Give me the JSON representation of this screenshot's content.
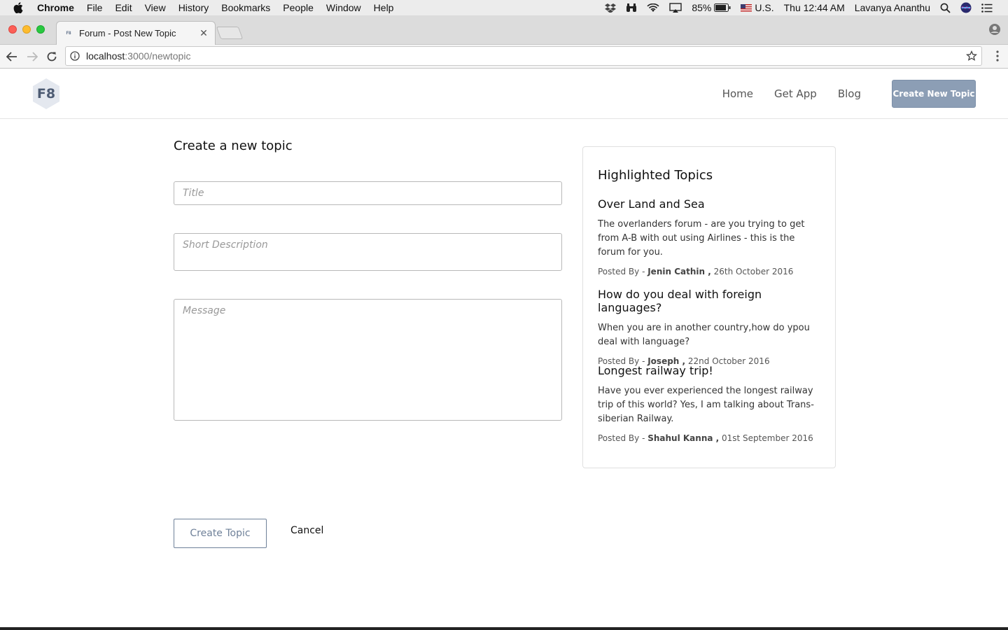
{
  "menubar": {
    "app_name": "Chrome",
    "items": [
      "File",
      "Edit",
      "View",
      "History",
      "Bookmarks",
      "People",
      "Window",
      "Help"
    ],
    "battery": "85%",
    "input_source": "U.S.",
    "clock": "Thu 12:44 AM",
    "user": "Lavanya Ananthu"
  },
  "browser": {
    "tab_title": "Forum - Post New Topic",
    "favicon_text": "F8",
    "url_host": "localhost",
    "url_path": ":3000/newtopic"
  },
  "header": {
    "logo_text": "F8",
    "nav": [
      "Home",
      "Get App",
      "Blog"
    ],
    "cta_label": "Create New Topic"
  },
  "form": {
    "heading": "Create a new topic",
    "title_placeholder": "Title",
    "description_placeholder": "Short Description",
    "message_placeholder": "Message",
    "submit_label": "Create Topic",
    "cancel_label": "Cancel"
  },
  "sidebar": {
    "heading": "Highlighted Topics",
    "topics": [
      {
        "title": "Over Land and Sea",
        "body": "The overlanders forum - are you trying to get from A-B with out using Airlines - this is the forum for you.",
        "posted_prefix": "Posted By - ",
        "author": "Jenin Cathin ,",
        "date": " 26th October 2016"
      },
      {
        "title": "How do you deal with foreign languages?",
        "body": "When you are in another country,how do ypou deal with language?",
        "posted_prefix": "Posted By - ",
        "author": "Joseph ,",
        "date": " 22nd October 2016"
      },
      {
        "title": "Longest railway trip!",
        "body": "Have you ever experienced the longest railway trip of this world? Yes, I am talking about Trans-siberian Railway.",
        "posted_prefix": "Posted By - ",
        "author": "Shahul Kanna ,",
        "date": " 01st September 2016"
      }
    ]
  }
}
